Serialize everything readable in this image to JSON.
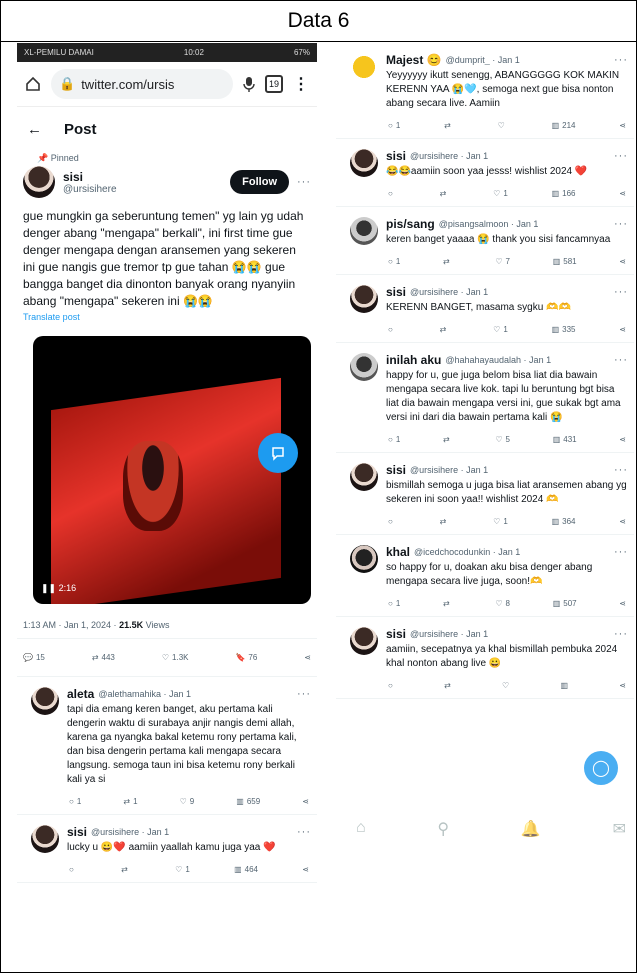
{
  "header": {
    "title": "Data 6"
  },
  "left": {
    "status": {
      "carrier": "XL-PEMILU DAMAI",
      "time": "10:02",
      "battery": "67%"
    },
    "url": "twitter.com/ursis",
    "tabs": "19",
    "post_label": "Post",
    "pinned": "Pinned",
    "author": {
      "name": "sisi",
      "handle": "@ursisihere",
      "follow": "Follow"
    },
    "text": "gue mungkin ga seberuntung temen\" yg lain yg udah denger abang \"mengapa\" berkali\", ini first time gue denger mengapa dengan aransemen yang sekeren ini gue nangis gue tremor tp gue tahan 😭😭 gue bangga banget dia dinonton banyak orang nyanyiin abang \"mengapa\" sekeren ini 😭😭",
    "translate": "Translate post",
    "video_time": "2:16",
    "time": "1:13 AM · Jan 1, 2024 · ",
    "views": "21.5K",
    "views_label": " Views",
    "stats": {
      "replies": "15",
      "reposts": "443",
      "likes": "1.3K",
      "bookmarks": "76"
    },
    "replies": [
      {
        "name": "aleta",
        "handle": "@alethamahika · Jan 1",
        "text": "tapi dia emang keren banget, aku pertama kali dengerin waktu di surabaya anjir nangis demi allah, karena ga nyangka bakal ketemu rony pertama kali, dan bisa dengerin pertama kali mengapa secara langsung. semoga taun ini bisa ketemu rony berkali kali ya si",
        "r": "1",
        "rt": "1",
        "l": "9",
        "v": "659"
      },
      {
        "name": "sisi",
        "handle": "@ursisihere · Jan 1",
        "text": "lucky u 😀❤️ aamiin yaallah kamu juga yaa ❤️",
        "r": "",
        "rt": "",
        "l": "1",
        "v": "464"
      }
    ]
  },
  "right": {
    "replies": [
      {
        "name": "Majest 😊",
        "handle": "@dumprit_ · Jan 1",
        "text": "Yeyyyyyy ikutt senengg, ABANGGGGG KOK MAKIN KERENN YAA 😭🩵, semoga next gue bisa nonton abang secara live. Aamiin",
        "r": "1",
        "rt": "",
        "l": "",
        "v": "214",
        "av": "duck"
      },
      {
        "name": "sisi",
        "handle": "@ursisihere · Jan 1",
        "text": "😂😂aamiin soon yaa jesss! wishlist 2024 ❤️",
        "r": "",
        "rt": "",
        "l": "1",
        "v": "166",
        "av": "girl"
      },
      {
        "name": "pis/sang",
        "handle": "@pisangsalmoon · Jan 1",
        "text": "keren banget yaaaa 😭 thank you sisi fancamnyaa",
        "r": "1",
        "rt": "",
        "l": "7",
        "v": "581",
        "av": "man"
      },
      {
        "name": "sisi",
        "handle": "@ursisihere · Jan 1",
        "text": "KERENN BANGET, masama sygku 🫶🫶",
        "r": "",
        "rt": "",
        "l": "1",
        "v": "335",
        "av": "girl"
      },
      {
        "name": "inilah aku",
        "handle": "@hahahayaudalah · Jan 1",
        "text": "happy for u, gue juga belom bisa liat dia bawain mengapa secara live kok. tapi lu beruntung bgt bisa liat dia bawain mengapa versi ini, gue sukak bgt ama versi ini dari dia bawain pertama kali 😭",
        "r": "1",
        "rt": "",
        "l": "5",
        "v": "431",
        "av": "man"
      },
      {
        "name": "sisi",
        "handle": "@ursisihere · Jan 1",
        "text": "bismillah semoga u juga bisa liat aransemen abang yg sekeren ini soon yaa!! wishlist 2024 🫶",
        "r": "",
        "rt": "",
        "l": "1",
        "v": "364",
        "av": "girl"
      },
      {
        "name": "khal",
        "handle": "@icedchocodunkin · Jan 1",
        "text": "so happy for u, doakan aku bisa denger abang mengapa secara live juga, soon!🫶",
        "r": "1",
        "rt": "",
        "l": "8",
        "v": "507",
        "av": "girl2"
      },
      {
        "name": "sisi",
        "handle": "@ursisihere · Jan 1",
        "text": "aamiin, secepatnya ya khal bismillah pembuka 2024 khal nonton abang live 😀",
        "r": "",
        "rt": "",
        "l": "",
        "v": "",
        "av": "girl"
      }
    ]
  }
}
